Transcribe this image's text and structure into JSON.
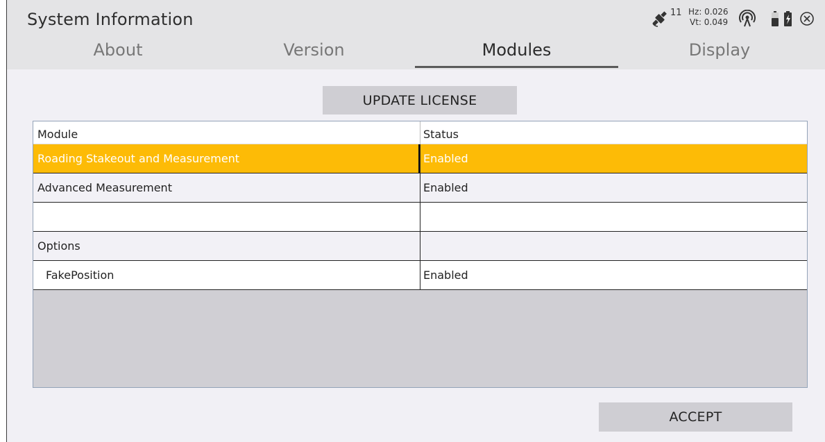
{
  "header": {
    "title": "System Information",
    "satellites": "11",
    "hz": "Hz: 0.026",
    "vt": "Vt: 0.049"
  },
  "tabs": [
    {
      "label": "About"
    },
    {
      "label": "Version"
    },
    {
      "label": "Modules"
    },
    {
      "label": "Display"
    }
  ],
  "active_tab": "Modules",
  "update_license_label": "UPDATE LICENSE",
  "table": {
    "columns": [
      "Module",
      "Status"
    ],
    "rows": [
      {
        "module": "Roading Stakeout and Measurement",
        "status": "Enabled",
        "selected": true
      },
      {
        "module": "Advanced Measurement",
        "status": "Enabled"
      },
      {
        "module": "",
        "status": ""
      },
      {
        "module": "Options",
        "status": ""
      },
      {
        "module": "FakePosition",
        "status": "Enabled"
      }
    ]
  },
  "accept_label": "ACCEPT",
  "colors": {
    "selected_row": "#fdbb06",
    "button_bg": "#cfced3",
    "header_bg": "#e4e4e6"
  }
}
